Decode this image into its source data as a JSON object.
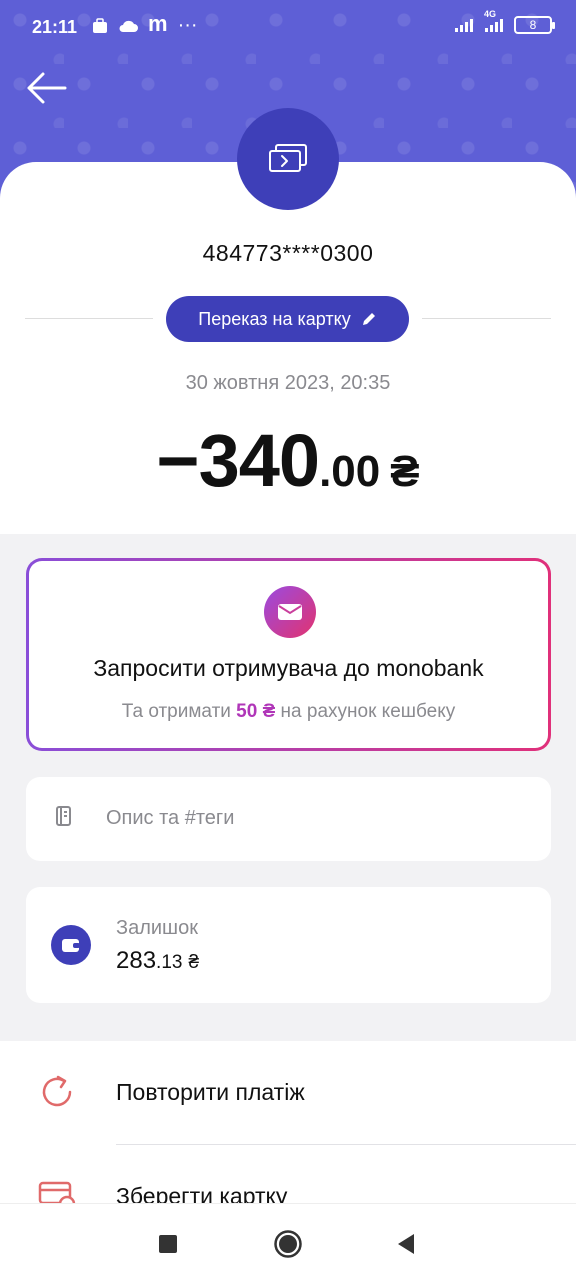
{
  "status_bar": {
    "time": "21:11",
    "app_indicator": "m",
    "more": "···",
    "network": "4G",
    "battery": "8"
  },
  "transaction": {
    "card_number": "484773****0300",
    "category": "Переказ на картку",
    "datetime": "30 жовтня 2023, 20:35",
    "amount_int": "−340",
    "amount_dec": ".00",
    "currency": "₴"
  },
  "invite": {
    "title": "Запросити отримувача до monobank",
    "sub_before": "Та отримати ",
    "sub_amount": "50 ₴",
    "sub_after": " на рахунок кешбеку"
  },
  "description": {
    "placeholder": "Опис та #теги"
  },
  "balance": {
    "label": "Залишок",
    "value_int": "283",
    "value_dec": ".13",
    "currency": "₴"
  },
  "actions": [
    {
      "label": "Повторити платіж",
      "icon": "repeat-icon"
    },
    {
      "label": "Зберегти картку",
      "icon": "save-card-icon"
    }
  ],
  "colors": {
    "header": "#5e5fd6",
    "accent": "#3e3fb8",
    "gradient_start": "#8a4ed8",
    "gradient_end": "#e0307a",
    "action_icon": "#e06a6a"
  }
}
